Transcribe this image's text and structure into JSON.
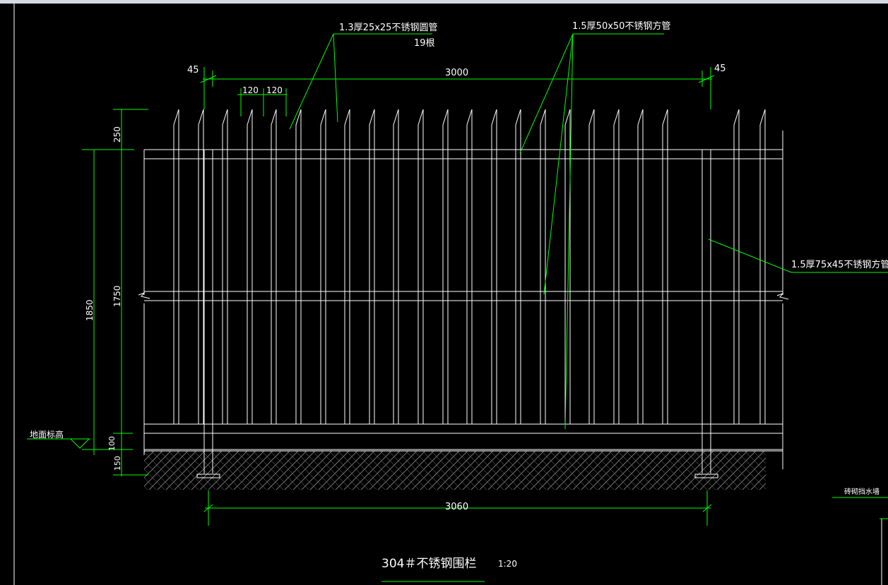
{
  "colors": {
    "background": "#000000",
    "geometry": "#ffffff",
    "dimension": "#00ff00",
    "hatch": "#8a8a8a",
    "toolbar": "#d6dbe2"
  },
  "drawing": {
    "title": "304＃不锈钢围栏",
    "scale": "1:20",
    "side_note": "砖砌挡水墙",
    "ground_label": "地面标高",
    "callouts": {
      "round_pipe": "1.3厚25x25不锈钢圆管",
      "round_pipe_count": "19根",
      "square_pipe": "1.5厚50x50不锈钢方管",
      "post_pipe": "1.5厚75x45不锈钢方管"
    },
    "dimensions": {
      "left_offset": "45",
      "span": "3000",
      "right_offset": "45",
      "spacing_a": "120",
      "spacing_b": "120",
      "total_width": "3060",
      "top_spike": "250",
      "panel_height": "1750",
      "total_height": "1850",
      "base": "100",
      "footing": "150"
    }
  }
}
